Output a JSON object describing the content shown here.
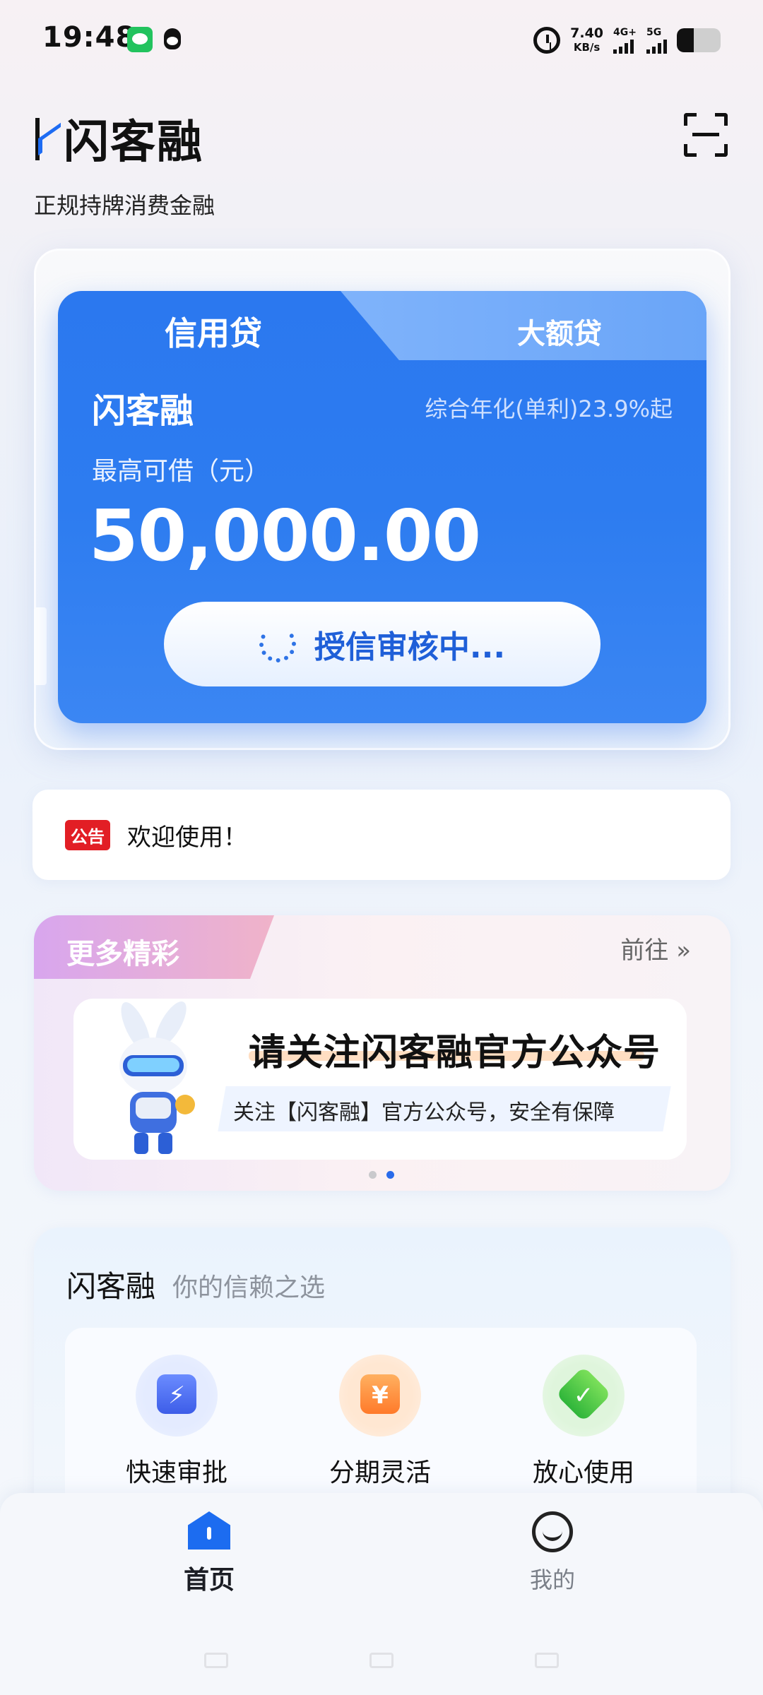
{
  "status_bar": {
    "time": "19:48",
    "net_speed_value": "7.40",
    "net_speed_unit": "KB/s",
    "sim1_type": "4G+",
    "sim2_type": "5G",
    "icons": [
      "wechat-icon",
      "qq-icon",
      "alarm-icon",
      "signal-icon",
      "battery-icon"
    ]
  },
  "header": {
    "brand": "闪客融",
    "tagline": "正规持牌消费金融"
  },
  "loan_card": {
    "tabs": [
      {
        "label": "信用贷",
        "active": true
      },
      {
        "label": "大额贷",
        "active": false
      }
    ],
    "product_name": "闪客融",
    "rate_text": "综合年化(单利)23.9%起",
    "limit_label": "最高可借（元）",
    "amount": "50,000.00",
    "status_button": "授信审核中..."
  },
  "notice": {
    "badge": "公告",
    "text": "欢迎使用！"
  },
  "more": {
    "title": "更多精彩",
    "link": "前往 »",
    "banner_title": "请关注闪客融官方公众号",
    "banner_subtitle": "关注【闪客融】官方公众号，安全有保障",
    "carousel_active_index": 1,
    "carousel_count": 2
  },
  "features": {
    "title": "闪客融",
    "subtitle": "你的信赖之选",
    "items": [
      {
        "label": "快速审批",
        "icon": "lightning-icon",
        "color": "#4f6ef2"
      },
      {
        "label": "分期灵活",
        "icon": "yuan-icon",
        "color": "#ff8a3a"
      },
      {
        "label": "放心使用",
        "icon": "check-shield-icon",
        "color": "#3cc144"
      }
    ]
  },
  "nav": {
    "items": [
      {
        "label": "首页",
        "icon": "home-icon",
        "active": true
      },
      {
        "label": "我的",
        "icon": "smile-icon",
        "active": false
      }
    ]
  },
  "colors": {
    "primary": "#2b78ef",
    "notice_badge": "#e21e25",
    "text_dark": "#111111"
  }
}
